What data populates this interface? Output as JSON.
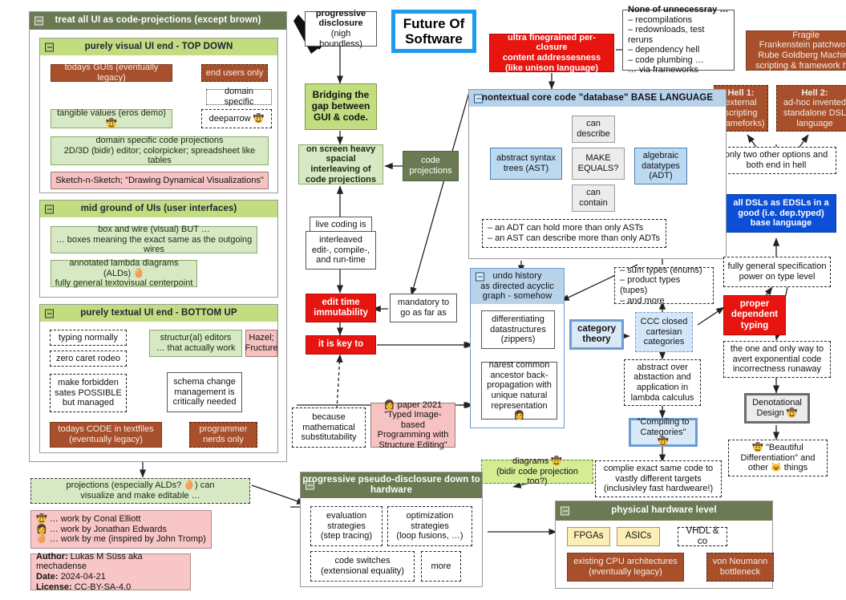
{
  "title_box": {
    "label": "Future Of\nSoftware"
  },
  "groups": {
    "ui_master": {
      "header": "treat all UI as code-projections (except brown)"
    },
    "visual_top": {
      "header": "purely visual UI end - TOP DOWN"
    },
    "mid_ground": {
      "header": "mid ground of UIs (user interfaces)"
    },
    "textual_bottom": {
      "header": "purely textual UI end - BOTTOM UP"
    },
    "base_language": {
      "header": "nontextual core code \"database\" BASE LANGUAGE"
    },
    "undo_history": {
      "header": "undo history\nas directed acyclic\ngraph - somehow"
    },
    "pseudo_disclosure": {
      "header": "progressive pseudo-disclosure\ndown to hardware"
    },
    "hardware": {
      "header": "physical hardware level"
    }
  },
  "visual_top_nodes": {
    "todays_guis": "todays GUIs (eventually legacy)",
    "end_users_only": "end users only",
    "domain_specific": "domain specific",
    "tangible_values": "tangible values (eros demo) 🤠",
    "deeparrow": "deeparrow 🤠",
    "domain_specific_code_projections": "domain specific code projections\n2D/3D (bidir) editor; colorpicker; spreadsheet like tables",
    "sketch_n_sketch": "Sketch-n-Sketch; \"Drawing Dynamical Visualizations\""
  },
  "mid_ground_nodes": {
    "box_and_wire": "box and wire (visual) BUT …\n… boxes meaning the exact same as the outgoing wires",
    "alds": "annotated lambda diagrams (ALDs) 🥚\nfully general textovisual centerpoint"
  },
  "textual_bottom_nodes": {
    "typing_normally": "typing normally",
    "zero_caret_rodeo": "zero caret rodeo",
    "make_forbidden": "make forbidden\nsates POSSIBLE\nbut managed",
    "structural_editors": "structur(al) editors\n… that actually work",
    "hazel_fructure": "Hazel;\nFructure",
    "schema_change": "schema change\nmanagement is\ncritically needed",
    "todays_code": "todays CODE in textfiles\n(eventually legacy)",
    "programmer_nerds": "programmer\nnerds only"
  },
  "left_bottom": {
    "projections_visualize": "projections (especially ALDs? 🥚) can\nvisualize and make editable …",
    "legend": "🤠 … work by Conal Elliott\n👩 … work by Jonathan Edwards\n🥚 … work by me (inspired by John Tromp)",
    "author_line": "Author: Lukas M Süss aka mechadense",
    "date_line": "Date: 2024-04-21",
    "license_line": "License: CC-BY-SA-4.0",
    "author_key": "Author:",
    "author_val": " Lukas M Süss aka mechadense",
    "date_key": "Date:",
    "date_val": " 2024-04-21",
    "license_key": "License:",
    "license_val": " CC-BY-SA-4.0"
  },
  "center_column": {
    "progressive_disclosure": "progressive\ndisclosure",
    "progressive_disclosure_sub": "(nigh boundless)",
    "bridging_gap": "Bridging the\ngap between\nGUI & code.",
    "on_screen_heavy": "on screen heavy\nspacial interleaving of\ncode projections",
    "code_projections": "code\nprojections",
    "live_coding": "live coding is\nthe default",
    "interleaved": "interleaved\nedit-, compile-,\nand run-time",
    "edit_time_immutability": "edit time\nimmutability",
    "mandatory_to_go": "mandatory to\ngo as far as",
    "it_is_key_to": "it is key to",
    "because_math": "because\nmathematical\nsubstitutability",
    "paper_2021": "👩 paper 2021\n\"Typed Image-based\nProgramming with\nStructure Editing\""
  },
  "top_right": {
    "ultra_finegrained": "ultra finegrained per-closure\ncontent addressesness\n(like unison language)",
    "none_unnecessary_title": "None of unnecessray …",
    "none_unnecessary_items": [
      "– recompilations",
      "– redownloads, test reruns",
      "– dependency hell",
      "– code plumbing …",
      "… via frameworks"
    ],
    "fragile": "Fragile\nFrankenstein patchwork\nRube Goldberg Machine\nscripting & framework hell",
    "hell1": "Hell 1:\nexternal\nscripting\n(frameforks)",
    "hell1_title": "Hell 1:",
    "hell1_body": "external\nscripting\n(frameforks)",
    "hell2_title": "Hell 2:",
    "hell2_body": "ad-hoc invented\nstandalone DSL\nlanguage",
    "only_two_options": "only two other options and\nboth end in hell",
    "all_dsls": "all DSLs as EDSLs in a\ngood (i.e. dep.typed)\nbase language"
  },
  "base_language_nodes": {
    "can_describe": "can\ndescribe",
    "can_contain": "can\ncontain",
    "ast": "abstract syntax\ntrees (AST)",
    "make_equals": "MAKE\nEQUALS?",
    "adt": "algebraic\ndatatypes\n(ADT)",
    "adt_notes": "– an ADT can hold more than only ASTs\n– an AST can describe more than only ADTs"
  },
  "undo_nodes": {
    "zippers": "differentiating\ndatastructures\n(zippers)",
    "narest": "narest common\nancestor back-\npropagation with\nunique natural\nrepresentation 👩"
  },
  "type_column": {
    "sum_product": "– sum types (enums)\n– product types (tupes)\n– and more",
    "category_theory": "category\ntheory",
    "ccc": "CCC closed\ncartesian\ncategories",
    "abstract_over": "abstract over\nabstaction and\napplication in\nlambda calculus",
    "compiling_to_categories": "\"Compiling to\nCategories\" 🤠"
  },
  "right_column": {
    "fully_general_spec": "fully general specification\npower on type level",
    "proper_dependent_typing": "proper\ndependent\ntyping",
    "one_and_only_way": "the one and only way to\navert exponential code\nincorrectness runaway",
    "denotational_design": "Denotational\nDesign 🤠",
    "beautiful_differentiation": "🤠 \"Beautiful\nDifferentiation\" and\nother 😺 things"
  },
  "hardware_section": {
    "diagrams": "diagrams 🤠\n(bidir code projection too?)",
    "compile_exact": "complie exact same code to\nvastly different targets\n(inclusivley fast hardweare!)",
    "evaluation_strategies": "evaluation\nstrategies\n(step tracing)",
    "optimization_strategies": "optimization\nstrategies\n(loop fusions, …)",
    "code_switches": "code switches\n(extensional equality)",
    "more": "more",
    "fpgas": "FPGAs",
    "asics": "ASICs",
    "vhdl": "VHDL & co",
    "existing_cpu": "existing CPU architectures\n(eventually legacy)",
    "von_neumann": "von Neumann\nbottleneck"
  },
  "colors": {
    "accent_red": "#e8140f",
    "accent_blue": "#0a4fd6",
    "brand_cyan": "#1e9bf0",
    "brown": "#a8502b",
    "olive": "#6b7a52",
    "lime": "#c2dd80",
    "pale_green": "#d7e8c4",
    "pale_blue": "#bcd9f2",
    "pink": "#f6c2c2"
  }
}
